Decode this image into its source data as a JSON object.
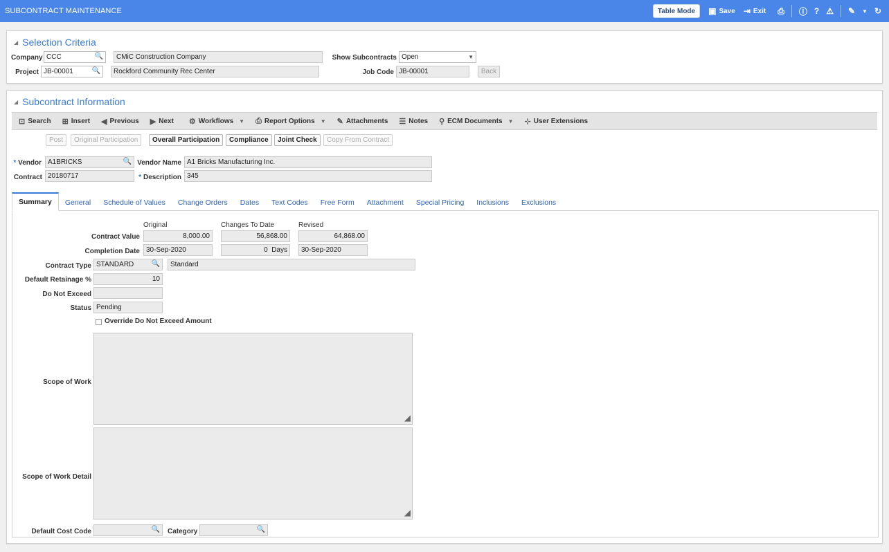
{
  "app": {
    "title": "SUBCONTRACT MAINTENANCE",
    "table_mode_label": "Table Mode",
    "save_label": "Save",
    "exit_label": "Exit"
  },
  "selection": {
    "title": "Selection Criteria",
    "company_label": "Company",
    "company_value": "CCC",
    "company_name": "CMiC Construction Company",
    "project_label": "Project",
    "project_value": "JB-00001",
    "project_name": "Rockford Community Rec Center",
    "show_label": "Show Subcontracts",
    "show_value": "Open",
    "jobcode_label": "Job Code",
    "jobcode_value": "JB-00001",
    "back_label": "Back"
  },
  "info": {
    "title": "Subcontract Information",
    "toolbar": {
      "search": "Search",
      "insert": "Insert",
      "previous": "Previous",
      "next": "Next",
      "workflows": "Workflows",
      "report_options": "Report Options",
      "attachments": "Attachments",
      "notes": "Notes",
      "ecm": "ECM Documents",
      "user_ext": "User Extensions"
    },
    "buttons": {
      "post": "Post",
      "original_participation": "Original Participation",
      "overall_participation": "Overall Participation",
      "compliance": "Compliance",
      "joint_check": "Joint Check",
      "copy_from_contract": "Copy From Contract"
    },
    "vendor_label": "Vendor",
    "vendor_value": "A1BRICKS",
    "vendor_name_label": "Vendor Name",
    "vendor_name_value": "A1 Bricks Manufacturing Inc.",
    "contract_label": "Contract",
    "contract_value": "20180717",
    "description_label": "Description",
    "description_value": "345",
    "required_marker": "*"
  },
  "tabs": [
    "Summary",
    "General",
    "Schedule of Values",
    "Change Orders",
    "Dates",
    "Text Codes",
    "Free Form",
    "Attachment",
    "Special Pricing",
    "Inclusions",
    "Exclusions"
  ],
  "summary": {
    "col_original": "Original",
    "col_changes": "Changes To Date",
    "col_revised": "Revised",
    "contract_value_label": "Contract Value",
    "contract_value_original": "8,000.00",
    "contract_value_changes": "56,868.00",
    "contract_value_revised": "64,868.00",
    "completion_date_label": "Completion Date",
    "completion_date_original": "30-Sep-2020",
    "completion_days": "0",
    "days_label": "Days",
    "completion_date_revised": "30-Sep-2020",
    "contract_type_label": "Contract Type",
    "contract_type_value": "STANDARD",
    "contract_type_desc": "Standard",
    "retainage_label": "Default Retainage %",
    "retainage_value": "10",
    "do_not_exceed_label": "Do Not Exceed",
    "do_not_exceed_value": "",
    "status_label": "Status",
    "status_value": "Pending",
    "override_label": "Override Do Not Exceed Amount",
    "scope_label": "Scope of Work",
    "scope_detail_label": "Scope of Work Detail",
    "cost_code_label": "Default Cost Code",
    "category_label": "Category"
  }
}
